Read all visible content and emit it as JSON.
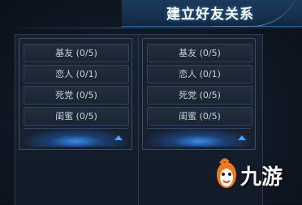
{
  "header": {
    "title": "建立好友关系"
  },
  "panels": [
    {
      "slots": [
        "基友 (0/5)",
        "恋人 (0/1)",
        "死党 (0/5)",
        "闺蜜 (0/5)"
      ]
    },
    {
      "slots": [
        "基友 (0/5)",
        "恋人 (0/1)",
        "死党 (0/5)",
        "闺蜜 (0/5)"
      ]
    }
  ],
  "watermark": {
    "text": "九游"
  },
  "colors": {
    "accent": "#4aa3ff",
    "title_bar": "#14304d"
  },
  "icons": {
    "expand": "caret-up-icon",
    "logo": "jiuyou-logo-icon"
  }
}
